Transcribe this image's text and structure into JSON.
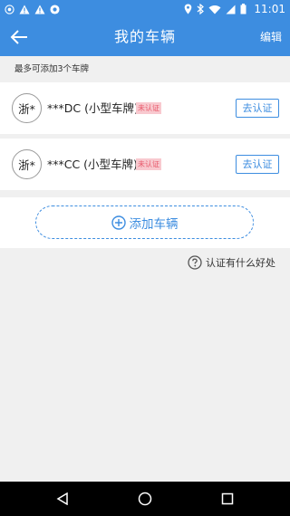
{
  "status_bar": {
    "time": "11:01",
    "icons": [
      "notification-icon",
      "warning-icon",
      "warning-icon",
      "app-icon",
      "location-icon",
      "bluetooth-icon",
      "wifi-icon",
      "signal-icon",
      "battery-icon"
    ]
  },
  "header": {
    "title": "我的车辆",
    "edit_label": "编辑"
  },
  "hint": "最多可添加3个车牌",
  "vehicles": [
    {
      "province": "浙*",
      "plate": "***DC (小型车牌)",
      "status": "未认证",
      "action": "去认证"
    },
    {
      "province": "浙*",
      "plate": "***CC (小型车牌)",
      "status": "未认证",
      "action": "去认证"
    }
  ],
  "add_button": {
    "label": "添加车辆"
  },
  "help": {
    "label": "认证有什么好处"
  },
  "colors": {
    "primary": "#3d8de0",
    "tag_bg": "#f8c9cf",
    "tag_text": "#e8586a"
  }
}
